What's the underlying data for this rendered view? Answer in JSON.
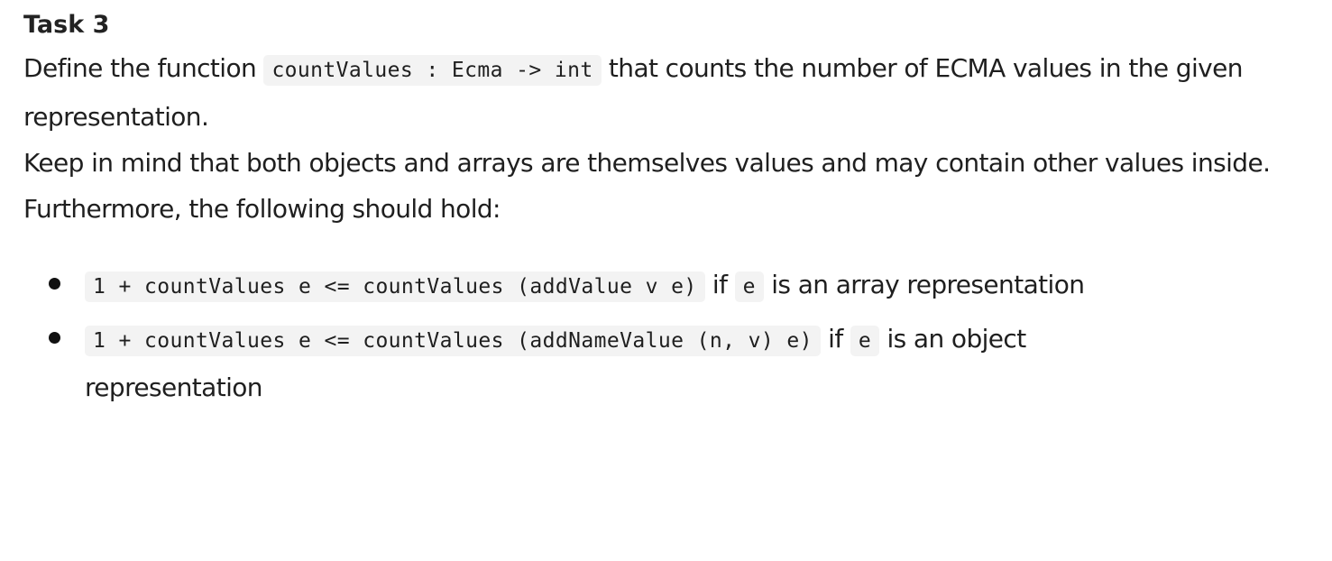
{
  "heading": "Task 3",
  "paragraph1": {
    "text_before": "Define the function ",
    "code": "countValues : Ecma -> int",
    "text_after": " that counts the number of ECMA values in the given representation."
  },
  "paragraph2": {
    "text": "Keep in mind that both objects and arrays are themselves values and may contain other values inside."
  },
  "paragraph3": {
    "text": "Furthermore, the following should hold:"
  },
  "rules": [
    {
      "code": "1 + countValues e <= countValues (addValue v e)",
      "text_mid": " if ",
      "code_var": "e",
      "text_after": " is an array representation"
    },
    {
      "code": "1 + countValues e <= countValues (addNameValue (n, v) e)",
      "text_mid": " if ",
      "code_var": "e",
      "text_after": " is an object representation"
    }
  ]
}
